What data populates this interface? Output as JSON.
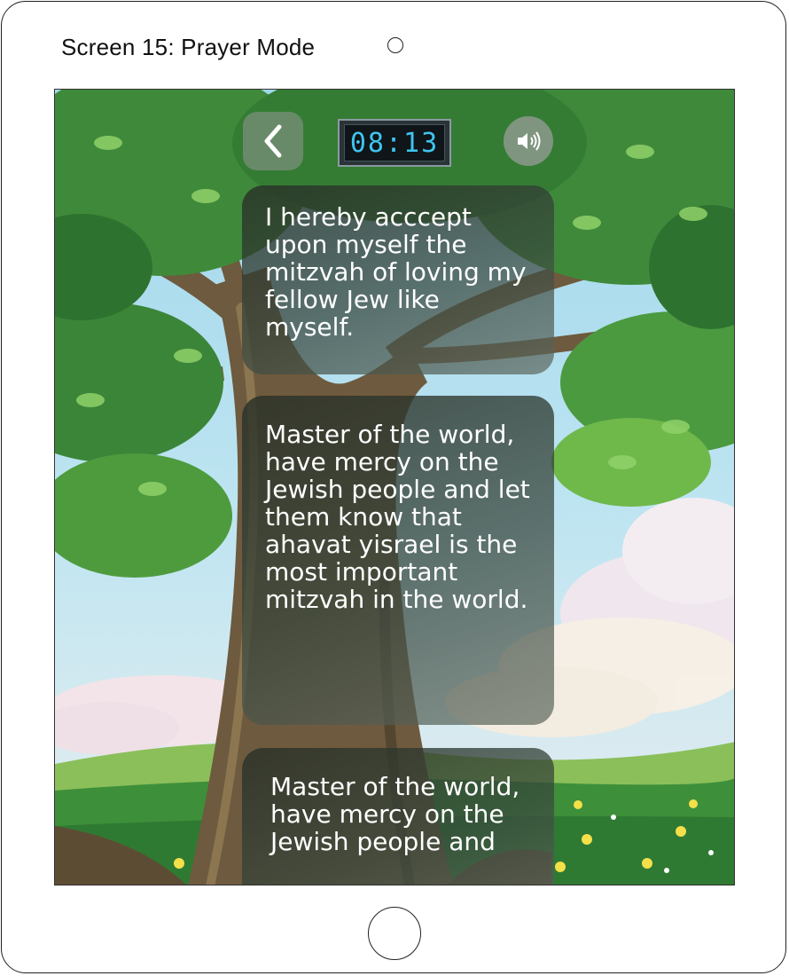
{
  "screen": {
    "title": "Screen 15: Prayer Mode"
  },
  "toolbar": {
    "back_icon": "chevron-left-icon",
    "clock_time": "08:13",
    "sound_icon": "speaker-icon"
  },
  "prayers": [
    {
      "text": "I hereby acccept upon myself the mitzvah of loving my fellow Jew like myself."
    },
    {
      "text": "Master of the world, have mercy on the Jewish people and let them know that ahavat yisrael is the most important mitzvah in the world."
    },
    {
      "text": "Master of the world, have mercy on the Jewish people and"
    }
  ],
  "colors": {
    "clock_digits": "#3ec5f0",
    "card_bg": "#2f3a30",
    "foliage": "#3f8a3a",
    "trunk": "#6e5a3e"
  }
}
